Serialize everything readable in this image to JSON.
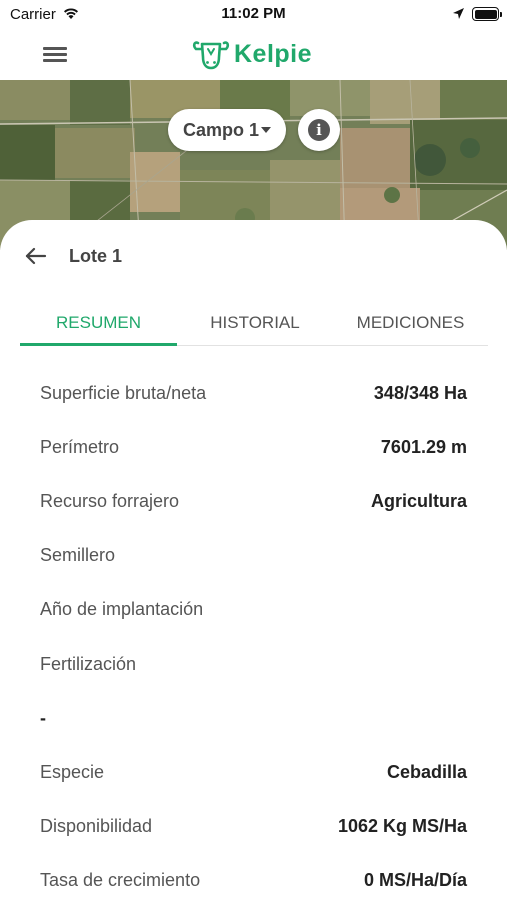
{
  "status_bar": {
    "carrier": "Carrier",
    "time": "11:02 PM"
  },
  "nav": {
    "brand": "Kelpie"
  },
  "map": {
    "field_selector": "Campo 1",
    "info_glyph": "i"
  },
  "lote": {
    "title": "Lote 1"
  },
  "tabs": [
    {
      "label": "RESUMEN",
      "active": true
    },
    {
      "label": "HISTORIAL",
      "active": false
    },
    {
      "label": "MEDICIONES",
      "active": false
    }
  ],
  "rows": [
    {
      "label": "Superficie bruta/neta",
      "value": "348/348 Ha"
    },
    {
      "label": "Perímetro",
      "value": "7601.29 m"
    },
    {
      "label": "Recurso forrajero",
      "value": "Agricultura"
    },
    {
      "label": "Semillero",
      "value": ""
    },
    {
      "label": "Año de implantación",
      "value": ""
    },
    {
      "label": "Fertilización",
      "value": ""
    },
    {
      "label": "-",
      "value": ""
    },
    {
      "label": "Especie",
      "value": "Cebadilla"
    },
    {
      "label": "Disponibilidad",
      "value": "1062 Kg MS/Ha"
    },
    {
      "label": "Tasa de crecimiento",
      "value": "0 MS/Ha/Día"
    }
  ],
  "colors": {
    "brand": "#20a86b",
    "text": "#555555",
    "value": "#222222"
  },
  "icons": [
    "wifi-icon",
    "location-arrow-icon",
    "battery-icon",
    "hamburger-menu-icon",
    "cow-logo-icon",
    "info-icon",
    "back-arrow-icon",
    "caret-down-icon"
  ]
}
